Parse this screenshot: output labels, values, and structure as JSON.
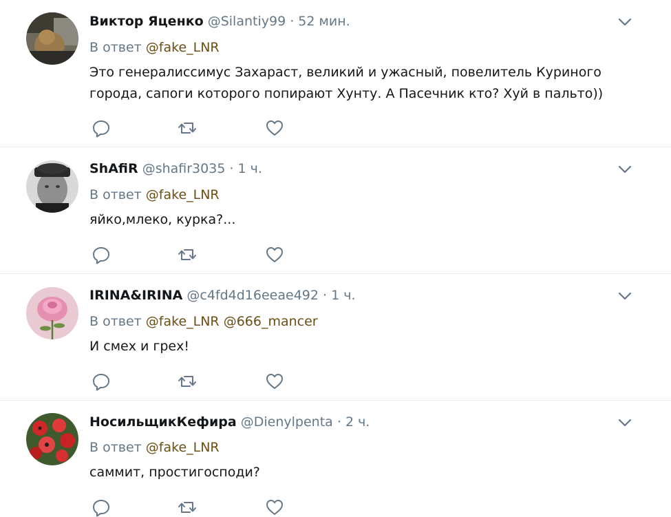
{
  "tweets": [
    {
      "name": "Виктор Яценко",
      "handle": "@Silantiy99",
      "separator": "·",
      "time": "52 мин.",
      "reply_prefix": "В ответ",
      "mentions": [
        "@fake_LNR"
      ],
      "text": "Это генералиссимус Захараст, великий и ужасный, повелитель Куриного города, сапоги которого попирают Хунту. А Пасечник кто? Хуй в пальто))"
    },
    {
      "name": "ShAfiR",
      "handle": "@shafir3035",
      "separator": "·",
      "time": "1 ч.",
      "reply_prefix": "В ответ",
      "mentions": [
        "@fake_LNR"
      ],
      "text": "яйко,млеко, курка?..."
    },
    {
      "name": "IRINA&IRINA",
      "handle": "@c4fd4d16eeae492",
      "separator": "·",
      "time": "1 ч.",
      "reply_prefix": "В ответ",
      "mentions": [
        "@fake_LNR",
        "@666_mancer"
      ],
      "text": "И смех и грех!"
    },
    {
      "name": "НосильщикКефира",
      "handle": "@Dienylpenta",
      "separator": "·",
      "time": "2 ч.",
      "reply_prefix": "В ответ",
      "mentions": [
        "@fake_LNR"
      ],
      "text": "саммит, простигосподи?"
    }
  ],
  "icons": {
    "reply": "reply-icon",
    "retweet": "retweet-icon",
    "like": "heart-icon",
    "more": "chevron-down-icon"
  },
  "colors": {
    "name": "#14171a",
    "meta": "#657786",
    "mention": "#6b4e14",
    "divider": "#e6ecf0"
  }
}
